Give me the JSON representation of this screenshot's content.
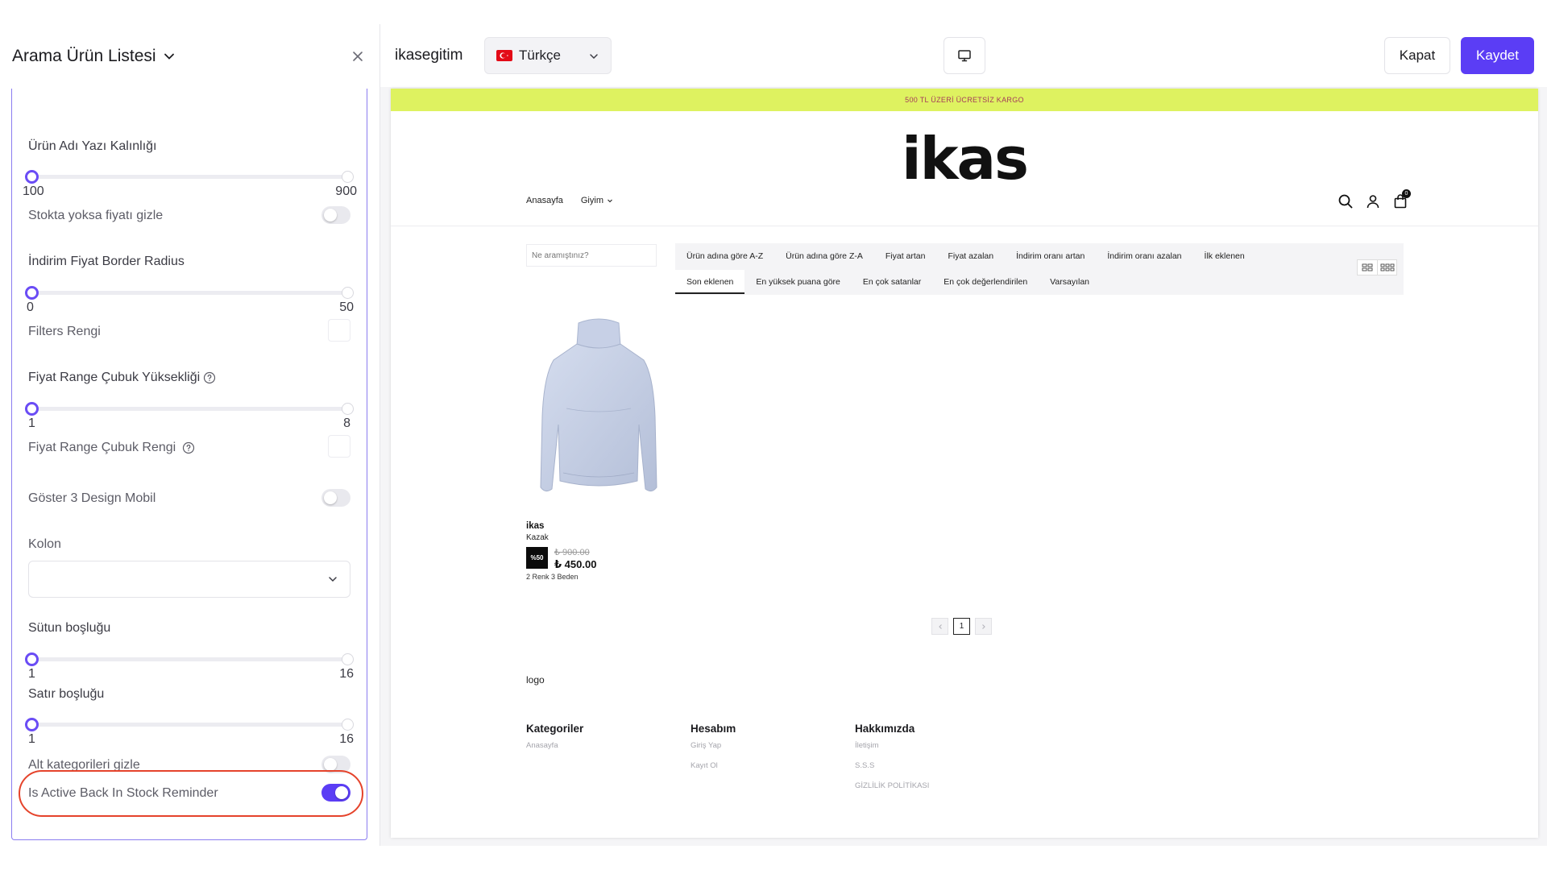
{
  "panel": {
    "title": "Arama Ürün Listesi",
    "settings": {
      "font_weight": {
        "label": "Ürün Adı Yazı Kalınlığı",
        "min": "100",
        "max": "900",
        "value": 100
      },
      "hide_price": {
        "label": "Stokta yoksa fiyatı gizle",
        "on": false
      },
      "discount_radius": {
        "label": "İndirim Fiyat Border Radius",
        "min": "0",
        "max": "50",
        "value": 0
      },
      "filters_color": {
        "label": "Filters Rengi"
      },
      "price_range_height": {
        "label": "Fiyat Range Çubuk Yüksekliği",
        "min": "1",
        "max": "8",
        "value": 1
      },
      "price_range_color": {
        "label": "Fiyat Range Çubuk Rengi"
      },
      "design3_mobile": {
        "label": "Göster 3 Design Mobil",
        "on": false
      },
      "column": {
        "label": "Kolon",
        "value": ""
      },
      "column_gap": {
        "label": "Sütun boşluğu",
        "min": "1",
        "max": "16",
        "value": 1
      },
      "row_gap": {
        "label": "Satır boşluğu",
        "min": "1",
        "max": "16",
        "value": 1
      },
      "hide_subcategories": {
        "label": "Alt kategorileri gizle",
        "on": false
      },
      "back_in_stock": {
        "label": "Is Active Back In Stock Reminder",
        "on": true
      }
    }
  },
  "topbar": {
    "site_name": "ikasegitim",
    "language": "Türkçe",
    "close_label": "Kapat",
    "save_label": "Kaydet"
  },
  "preview": {
    "announcement": "500 TL ÜZERİ ÜCRETSİZ KARGO",
    "logo": "ikas",
    "nav": [
      "Anasayfa",
      "Giyim"
    ],
    "cart_count": "0",
    "search_placeholder": "Ne aramıştınız?",
    "sort_row1": [
      "Ürün adına göre A-Z",
      "Ürün adına göre Z-A",
      "Fiyat artan",
      "Fiyat azalan",
      "İndirim oranı artan",
      "İndirim oranı azalan",
      "İlk eklenen"
    ],
    "sort_row2": [
      "Son eklenen",
      "En yüksek puana göre",
      "En çok satanlar",
      "En çok değerlendirilen",
      "Varsayılan"
    ],
    "product": {
      "brand": "ikas",
      "name": "Kazak",
      "discount": "%50",
      "old_price": "₺ 900.00",
      "new_price": "₺ 450.00",
      "variants": "2 Renk 3 Beden"
    },
    "page": "1",
    "footer_logo": "logo",
    "footer": [
      {
        "title": "Kategoriler",
        "links": [
          "Anasayfa"
        ]
      },
      {
        "title": "Hesabım",
        "links": [
          "Giriş Yap",
          "Kayıt Ol"
        ]
      },
      {
        "title": "Hakkımızda",
        "links": [
          "İletişim",
          "S.S.S",
          "GİZLİLİK POLİTİKASI"
        ]
      }
    ]
  },
  "colors": {
    "accent": "#5b3df5",
    "highlight": "#e5432b",
    "announcement_bg": "#def260"
  },
  "icons": {
    "close": "close-icon",
    "chevron": "chevron-down-icon",
    "help": "help-circle-icon",
    "desktop": "desktop-icon",
    "search": "search-icon",
    "user": "user-icon",
    "cart": "shopping-bag-icon",
    "grid2": "grid-2-icon",
    "grid3": "grid-3-icon",
    "prev": "chevron-left-icon",
    "next": "chevron-right-icon"
  }
}
